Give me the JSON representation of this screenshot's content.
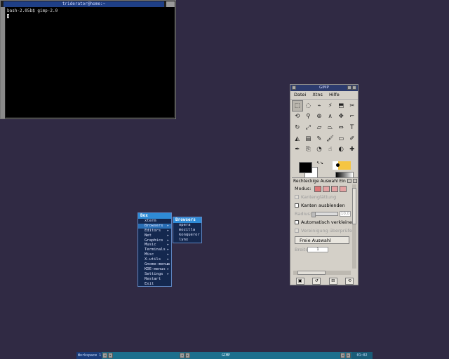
{
  "terminal": {
    "title": "triderator@home:~",
    "lines": [
      "bash-2.05b$ gimp-2.0"
    ]
  },
  "box_menu": {
    "title": "Box",
    "items": [
      {
        "label": "xterm",
        "submenu": false
      },
      {
        "label": "Browsers",
        "submenu": true,
        "selected": true
      },
      {
        "label": "Editors",
        "submenu": true
      },
      {
        "label": "Net",
        "submenu": true
      },
      {
        "label": "Graphics",
        "submenu": true
      },
      {
        "label": "Music",
        "submenu": true
      },
      {
        "label": "Terminals",
        "submenu": true
      },
      {
        "label": "Misc",
        "submenu": true
      },
      {
        "label": "X-utils",
        "submenu": true
      },
      {
        "label": "Gnome-menus",
        "submenu": true
      },
      {
        "label": "KDE-menus",
        "submenu": true
      },
      {
        "label": "Settings",
        "submenu": true
      },
      {
        "label": "Restart",
        "submenu": false
      },
      {
        "label": "Exit",
        "submenu": false
      }
    ],
    "submenu": {
      "title": "Browsers",
      "items": [
        "opera",
        "mozilla",
        "konqueror",
        "lynx"
      ]
    }
  },
  "gimp": {
    "title": "GIMP",
    "menu": [
      "Datei",
      "Xtns",
      "Hilfe"
    ],
    "tools": [
      {
        "icon": "rect-select-icon",
        "glyph": "⬚",
        "selected": true
      },
      {
        "icon": "ellipse-select-icon",
        "glyph": "◌"
      },
      {
        "icon": "lasso-icon",
        "glyph": "⌁"
      },
      {
        "icon": "fuzzy-select-icon",
        "glyph": "⚡"
      },
      {
        "icon": "color-select-icon",
        "glyph": "⬒"
      },
      {
        "icon": "scissors-icon",
        "glyph": "✂"
      },
      {
        "icon": "paths-icon",
        "glyph": "⟲"
      },
      {
        "icon": "color-picker-icon",
        "glyph": "⚲"
      },
      {
        "icon": "zoom-icon",
        "glyph": "⊕"
      },
      {
        "icon": "measure-icon",
        "glyph": "∧"
      },
      {
        "icon": "move-icon",
        "glyph": "✥"
      },
      {
        "icon": "crop-icon",
        "glyph": "⌐"
      },
      {
        "icon": "rotate-icon",
        "glyph": "↻"
      },
      {
        "icon": "scale-icon",
        "glyph": "⤢"
      },
      {
        "icon": "shear-icon",
        "glyph": "▱"
      },
      {
        "icon": "perspective-icon",
        "glyph": "⏢"
      },
      {
        "icon": "flip-icon",
        "glyph": "⇔"
      },
      {
        "icon": "text-icon",
        "glyph": "T"
      },
      {
        "icon": "bucket-fill-icon",
        "glyph": "◭"
      },
      {
        "icon": "blend-icon",
        "glyph": "▤"
      },
      {
        "icon": "pencil-icon",
        "glyph": "✎"
      },
      {
        "icon": "paintbrush-icon",
        "glyph": "🖌"
      },
      {
        "icon": "eraser-icon",
        "glyph": "▭"
      },
      {
        "icon": "airbrush-icon",
        "glyph": "✐"
      },
      {
        "icon": "ink-icon",
        "glyph": "✒"
      },
      {
        "icon": "clone-icon",
        "glyph": "⎘"
      },
      {
        "icon": "convolve-icon",
        "glyph": "◔"
      },
      {
        "icon": "smudge-icon",
        "glyph": "☝"
      },
      {
        "icon": "dodge-burn-icon",
        "glyph": "◐"
      },
      {
        "icon": "heal-icon",
        "glyph": "✚"
      }
    ],
    "tool_options": {
      "title": "Rechteckige Auswahl Ein",
      "mode_label": "Modus:",
      "antialias": "Kantenglättung",
      "feather": "Kanten ausblenden",
      "radius_label": "Radius:",
      "radius_value": "10,0",
      "auto_shrink": "Automatisch verkleiner",
      "merge_visible": "Vereinigung überprüfen",
      "free_select": "Freie Auswahl",
      "width_label": "Breite:",
      "width_value": "1"
    }
  },
  "taskbar": {
    "workspace": "Workspace 1",
    "task": "GIMP",
    "clock": "01:02"
  }
}
